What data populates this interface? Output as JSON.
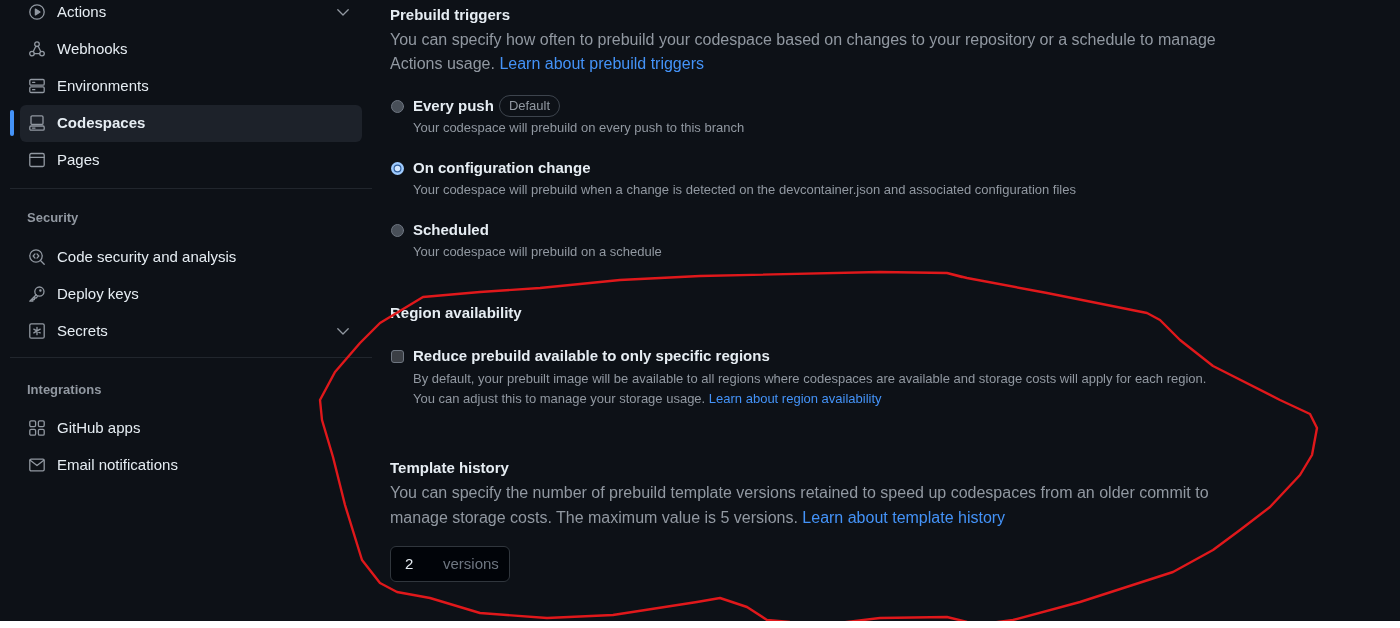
{
  "sidebar": {
    "sections": [
      {
        "items": [
          {
            "label": "Actions",
            "kind": "expandable",
            "expanded": false,
            "selected": false
          },
          {
            "label": "Webhooks",
            "kind": "link",
            "selected": false
          },
          {
            "label": "Environments",
            "kind": "link",
            "selected": false
          },
          {
            "label": "Codespaces",
            "kind": "link",
            "selected": true
          },
          {
            "label": "Pages",
            "kind": "link",
            "selected": false
          }
        ]
      },
      {
        "heading": "Security",
        "items": [
          {
            "label": "Code security and analysis",
            "kind": "link",
            "selected": false
          },
          {
            "label": "Deploy keys",
            "kind": "link",
            "selected": false
          },
          {
            "label": "Secrets",
            "kind": "expandable",
            "expanded": false,
            "selected": false
          }
        ]
      },
      {
        "heading": "Integrations",
        "items": [
          {
            "label": "GitHub apps",
            "kind": "link",
            "selected": false
          },
          {
            "label": "Email notifications",
            "kind": "link",
            "selected": false
          }
        ]
      }
    ]
  },
  "prebuild_triggers": {
    "title": "Prebuild triggers",
    "description": "You can specify how often to prebuild your codespace based on changes to your repository or a schedule to manage Actions usage.",
    "link": "Learn about prebuild triggers",
    "options": [
      {
        "label": "Every push",
        "badge": "Default",
        "description": "Your codespace will prebuild on every push to this branch",
        "selected": false
      },
      {
        "label": "On configuration change",
        "description": "Your codespace will prebuild when a change is detected on the devcontainer.json and associated configuration files",
        "selected": true
      },
      {
        "label": "Scheduled",
        "description": "Your codespace will prebuild on a schedule",
        "selected": false
      }
    ]
  },
  "region_availability": {
    "title": "Region availability",
    "checkbox": {
      "label": "Reduce prebuild available to only specific regions",
      "checked": false,
      "description_lines": [
        "By default, your prebuilt image will be available to all regions where codespaces are available and storage costs will apply for each region.",
        "You can adjust this to manage your storage usage."
      ],
      "link": "Learn about region availability"
    }
  },
  "template_history": {
    "title": "Template history",
    "description": "You can specify the number of prebuild template versions retained to speed up codespaces from an older commit to manage storage costs. The maximum value is 5 versions.",
    "link": "Learn about template history",
    "input": {
      "value": "2",
      "suffix": "versions"
    }
  }
}
